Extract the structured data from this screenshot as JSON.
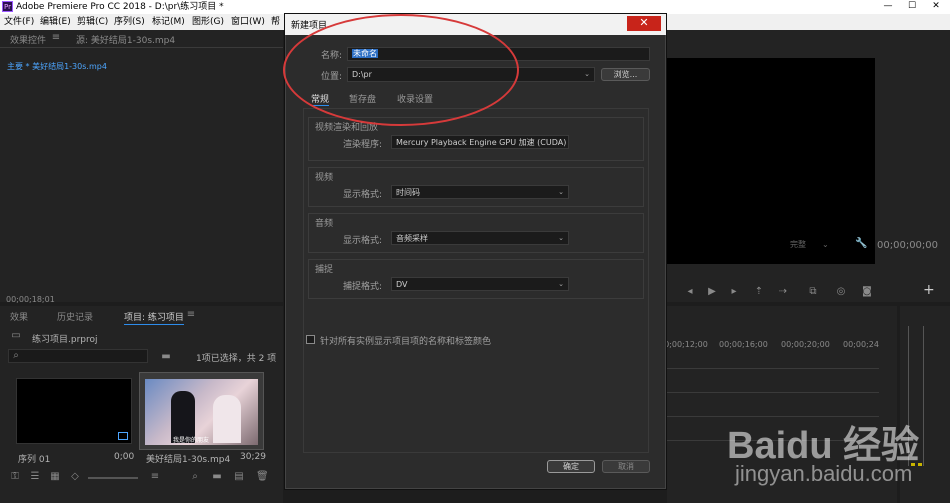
{
  "window": {
    "title": "Adobe Premiere Pro CC 2018 - D:\\pr\\练习项目 *",
    "app_icon": "Pr",
    "controls": {
      "minimize": "—",
      "maximize": "☐",
      "close": "✕"
    }
  },
  "menu": [
    "文件(F)",
    "编辑(E)",
    "剪辑(C)",
    "序列(S)",
    "标记(M)",
    "图形(G)",
    "窗口(W)",
    "帮"
  ],
  "source_panel": {
    "tabs": [
      "效果控件",
      "源: 美好结局1-30s.mp4"
    ],
    "clip_label": "主要 * 美好结局1-30s.mp4",
    "timecode": "00;00;18;01"
  },
  "project_panel": {
    "tabs": [
      "效果",
      "历史记录",
      "项目: 练习项目"
    ],
    "file_name": "练习项目.prproj",
    "selection_info": "1项已选择，共 2 项",
    "items": [
      {
        "name": "序列 01",
        "duration": "0;00"
      },
      {
        "name": "美好结局1-30s.mp4",
        "duration": "30;29"
      }
    ],
    "thumb_caption": "我是你的朋友"
  },
  "program_monitor": {
    "fit": "完整",
    "timecode": "00;00;00;00"
  },
  "timeline": {
    "ticks": [
      "00;00;12;00",
      "00;00;16;00",
      "00;00;20;00",
      "00;00;24"
    ]
  },
  "dialog": {
    "title": "新建项目",
    "close": "✕",
    "name_label": "名称:",
    "name_value": "未命名",
    "location_label": "位置:",
    "location_value": "D:\\pr",
    "browse_button": "浏览...",
    "tabs": [
      "常规",
      "暂存盘",
      "收录设置"
    ],
    "renderer_group": {
      "title": "视频渲染和回放",
      "label": "渲染程序:",
      "value": "Mercury Playback Engine GPU 加速 (CUDA)"
    },
    "video_group": {
      "title": "视频",
      "label": "显示格式:",
      "value": "时间码"
    },
    "audio_group": {
      "title": "音频",
      "label": "显示格式:",
      "value": "音频采样"
    },
    "capture_group": {
      "title": "捕捉",
      "label": "捕捉格式:",
      "value": "DV"
    },
    "checkbox_label": "针对所有实例显示项目项的名称和标签颜色",
    "ok_button": "确定",
    "cancel_button": "取消"
  },
  "watermark": {
    "logo": "Baidu 经验",
    "url": "jingyan.baidu.com"
  }
}
